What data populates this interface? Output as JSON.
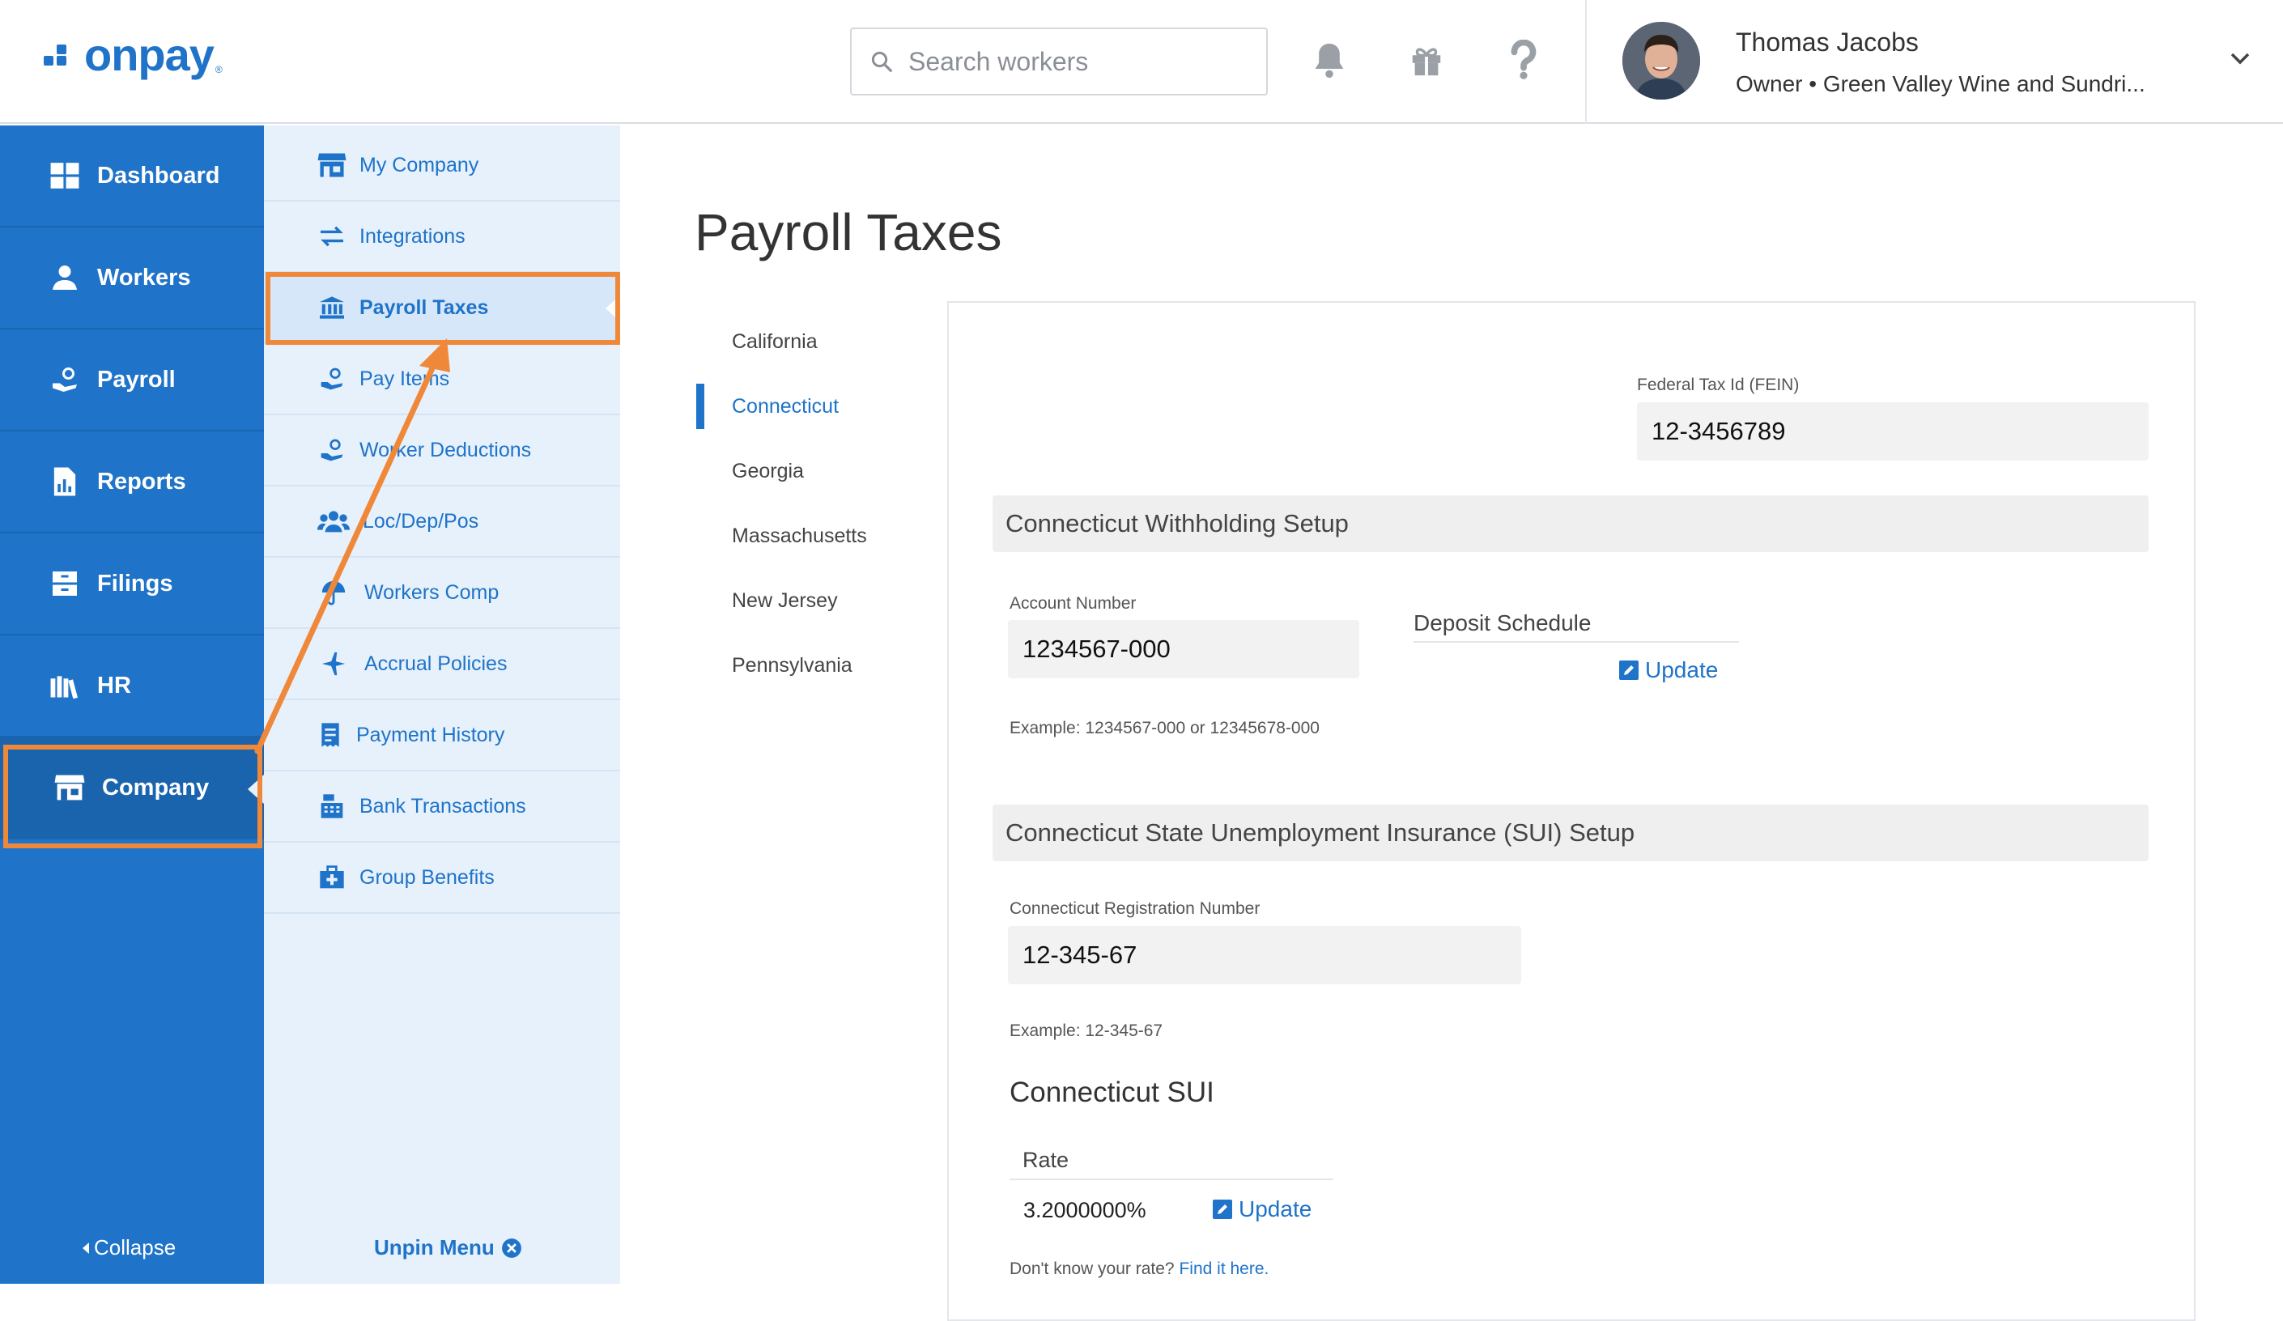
{
  "brand": {
    "logo_text": "onpay",
    "logo_reg": "®",
    "accent": "#1f73c8",
    "highlight": "#f0883a"
  },
  "header": {
    "search_placeholder": "Search workers",
    "icons": [
      "bell-icon",
      "gift-icon",
      "help-icon"
    ],
    "user_name": "Thomas Jacobs",
    "user_subtitle": "Owner • Green Valley Wine and Sundri..."
  },
  "leftnav": {
    "items": [
      {
        "label": "Dashboard",
        "icon": "dashboard-icon"
      },
      {
        "label": "Workers",
        "icon": "workers-icon"
      },
      {
        "label": "Payroll",
        "icon": "payroll-icon"
      },
      {
        "label": "Reports",
        "icon": "reports-icon"
      },
      {
        "label": "Filings",
        "icon": "filings-icon"
      },
      {
        "label": "HR",
        "icon": "hr-icon"
      },
      {
        "label": "Company",
        "icon": "company-icon",
        "active": true
      }
    ],
    "collapse_label": "Collapse"
  },
  "subnav": {
    "items": [
      {
        "label": "My Company",
        "icon": "store-icon"
      },
      {
        "label": "Integrations",
        "icon": "swap-icon"
      },
      {
        "label": "Payroll Taxes",
        "icon": "bank-icon",
        "active": true
      },
      {
        "label": "Pay Items",
        "icon": "hand-money-icon"
      },
      {
        "label": "Worker Deductions",
        "icon": "hand-money-icon"
      },
      {
        "label": "Loc/Dep/Pos",
        "icon": "users-icon"
      },
      {
        "label": "Workers Comp",
        "icon": "umbrella-icon"
      },
      {
        "label": "Accrual Policies",
        "icon": "plane-icon"
      },
      {
        "label": "Payment History",
        "icon": "receipt-icon"
      },
      {
        "label": "Bank Transactions",
        "icon": "register-icon"
      },
      {
        "label": "Group Benefits",
        "icon": "medkit-icon"
      }
    ],
    "unpin_label": "Unpin Menu"
  },
  "main": {
    "title": "Payroll Taxes",
    "states": [
      "California",
      "Connecticut",
      "Georgia",
      "Massachusetts",
      "New Jersey",
      "Pennsylvania"
    ],
    "active_state": "Connecticut",
    "fein": {
      "label": "Federal Tax Id (FEIN)",
      "value": "12-3456789"
    },
    "withholding": {
      "heading": "Connecticut Withholding Setup",
      "account_label": "Account Number",
      "account_value": "1234567-000",
      "account_example": "Example: 1234567-000 or 12345678-000",
      "deposit_label": "Deposit Schedule",
      "update_label": "Update"
    },
    "sui": {
      "heading": "Connecticut State Unemployment Insurance (SUI) Setup",
      "reg_label": "Connecticut Registration Number",
      "reg_value": "12-345-67",
      "reg_example": "Example: 12-345-67",
      "subheading": "Connecticut SUI",
      "rate_label": "Rate",
      "rate_value": "3.2000000%",
      "update_label": "Update",
      "help_text": "Don't know your rate?",
      "help_link": "Find it here."
    }
  }
}
